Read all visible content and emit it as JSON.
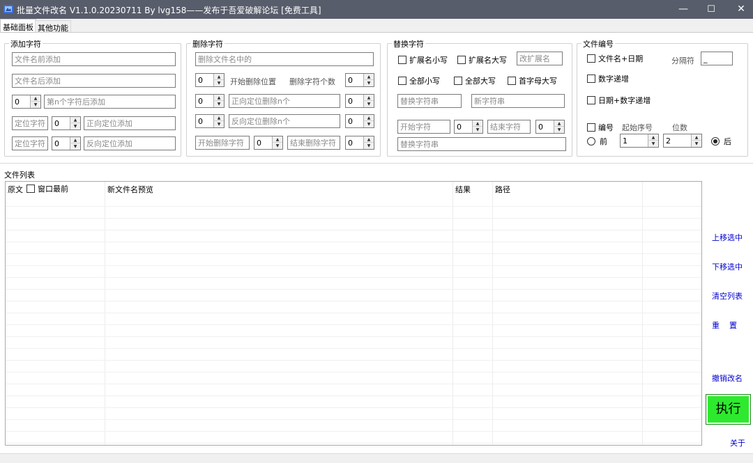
{
  "window": {
    "title": "批量文件改名  V1.1.0.20230711  By lvg158——发布于吾爱破解论坛 [免费工具]",
    "minimize": "—",
    "maximize": "☐",
    "close": "✕"
  },
  "tabs": [
    {
      "label": "基础面板",
      "active": true
    },
    {
      "label": "其他功能",
      "active": false
    }
  ],
  "add_chars": {
    "title": "添加字符",
    "prefix_placeholder": "文件名前添加",
    "suffix_placeholder": "文件名后添加",
    "nth_value": "0",
    "nth_placeholder": "第n个字符后添加",
    "locate1_placeholder": "定位字符",
    "locate1_num": "0",
    "forward_placeholder": "正向定位添加",
    "locate2_placeholder": "定位字符",
    "locate2_num": "0",
    "reverse_placeholder": "反向定位添加"
  },
  "delete_chars": {
    "title": "删除字符",
    "delete_placeholder": "删除文件名中的",
    "start_pos_value": "0",
    "start_pos_label": "开始删除位置",
    "count_label": "删除字符个数",
    "count_value": "0",
    "fwd_value": "0",
    "fwd_placeholder": "正向定位删除n个",
    "fwd_n_value": "0",
    "rev_value": "0",
    "rev_placeholder": "反向定位删除n个",
    "rev_n_value": "0",
    "start_char_placeholder": "开始删除字符",
    "mid_value": "0",
    "end_char_placeholder": "结束删除字符",
    "end_value": "0"
  },
  "replace_chars": {
    "title": "替换字符",
    "ext_lower": "扩展名小写",
    "ext_upper": "扩展名大写",
    "change_ext_placeholder": "改扩展名",
    "all_lower": "全部小写",
    "all_upper": "全部大写",
    "cap_first": "首字母大写",
    "replace_str_placeholder": "替换字符串",
    "new_str_placeholder": "新字符串",
    "start_char_placeholder": "开始字符",
    "start_num": "0",
    "end_char_placeholder": "结束字符",
    "end_num": "0",
    "replace_str2_placeholder": "替换字符串"
  },
  "numbering": {
    "title": "文件编号",
    "name_date": "文件名+日期",
    "separator_label": "分隔符",
    "separator_value": "_",
    "num_increment": "数字递增",
    "date_num_increment": "日期+数字递增",
    "number_label": "编号",
    "start_seq_label": "起始序号",
    "digits_label": "位数",
    "before_label": "前",
    "start_seq_value": "1",
    "digits_value": "2",
    "after_label": "后",
    "position_selected": "后"
  },
  "file_list": {
    "title": "文件列表",
    "topmost_label": "窗口最前",
    "columns": [
      "原文",
      "新文件名预览",
      "结果",
      "路径"
    ]
  },
  "side_actions": {
    "move_up": "上移选中",
    "move_down": "下移选中",
    "clear_list": "清空列表",
    "reset": "重    置",
    "undo": "撤销改名",
    "execute": "执行",
    "about": "关于"
  }
}
